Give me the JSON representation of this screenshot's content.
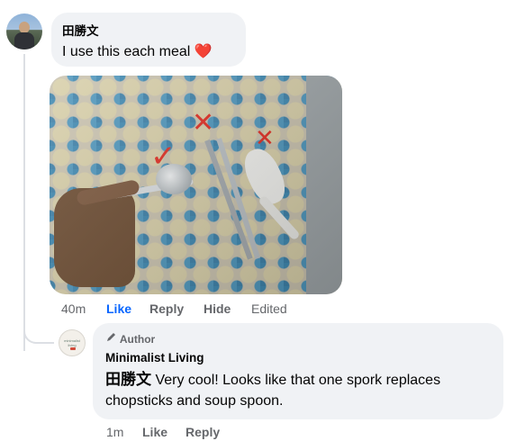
{
  "main_comment": {
    "author": "田勝文",
    "text": "I use this each meal",
    "emoji": "❤️",
    "image_marks": {
      "check": "✓",
      "x1": "✕",
      "x2": "✕"
    },
    "actions": {
      "time": "40m",
      "like": "Like",
      "reply": "Reply",
      "hide": "Hide",
      "edited": "Edited"
    }
  },
  "reply_comment": {
    "badge_icon": "pencil-icon",
    "badge": "Author",
    "author": "Minimalist Living",
    "mention": "田勝文",
    "text": " Very cool! Looks like that one spork replaces chopsticks and soup spoon.",
    "avatar_logo": "minimalist living",
    "actions": {
      "time": "1m",
      "like": "Like",
      "reply": "Reply"
    }
  },
  "colors": {
    "like_active": "#0866ff",
    "bubble": "#f0f2f5",
    "meta": "#65676b",
    "heart": "#e41e3f"
  }
}
